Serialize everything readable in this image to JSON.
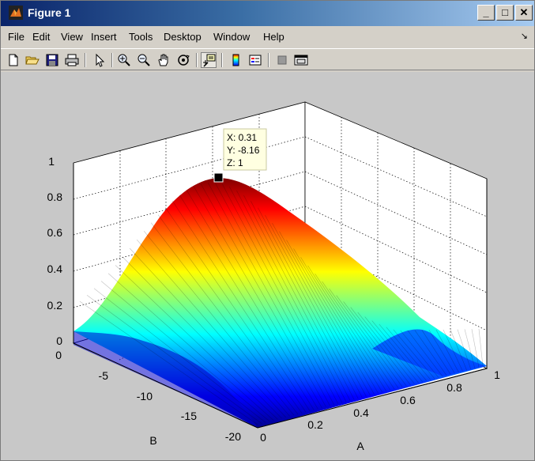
{
  "window": {
    "title": "Figure 1"
  },
  "title_buttons": {
    "minimize": "_",
    "maximize": "□",
    "close": "✕"
  },
  "menu": [
    "File",
    "Edit",
    "View",
    "Insert",
    "Tools",
    "Desktop",
    "Window",
    "Help"
  ],
  "menu_arrow": "↘",
  "toolbar": [
    "new-figure-icon",
    "open-file-icon",
    "save-icon",
    "print-icon",
    "select-arrow-icon",
    "zoom-in-icon",
    "zoom-out-icon",
    "pan-hand-icon",
    "rotate-3d-icon",
    "data-cursor-icon",
    "colorbar-icon",
    "legend-icon",
    "hide-plot-tools-icon",
    "show-plot-tools-icon"
  ],
  "chart_data": {
    "type": "surface",
    "xlabel": "A",
    "ylabel": "B",
    "zlabel": "",
    "x_ticks": [
      "0",
      "0.2",
      "0.4",
      "0.6",
      "0.8",
      "1"
    ],
    "y_ticks": [
      "0",
      "-5",
      "-10",
      "-15",
      "-20"
    ],
    "z_ticks": [
      "0",
      "0.2",
      "0.4",
      "0.6",
      "0.8",
      "1"
    ],
    "xlim": [
      0,
      1
    ],
    "ylim": [
      -20,
      0
    ],
    "zlim": [
      0,
      1
    ],
    "grid": true,
    "colormap": "jet",
    "peak": {
      "x": 0.31,
      "y": -8.16,
      "z": 1
    },
    "datatip": {
      "x": "X: 0.31",
      "y": "Y: -8.16",
      "z": "Z: 1"
    }
  }
}
